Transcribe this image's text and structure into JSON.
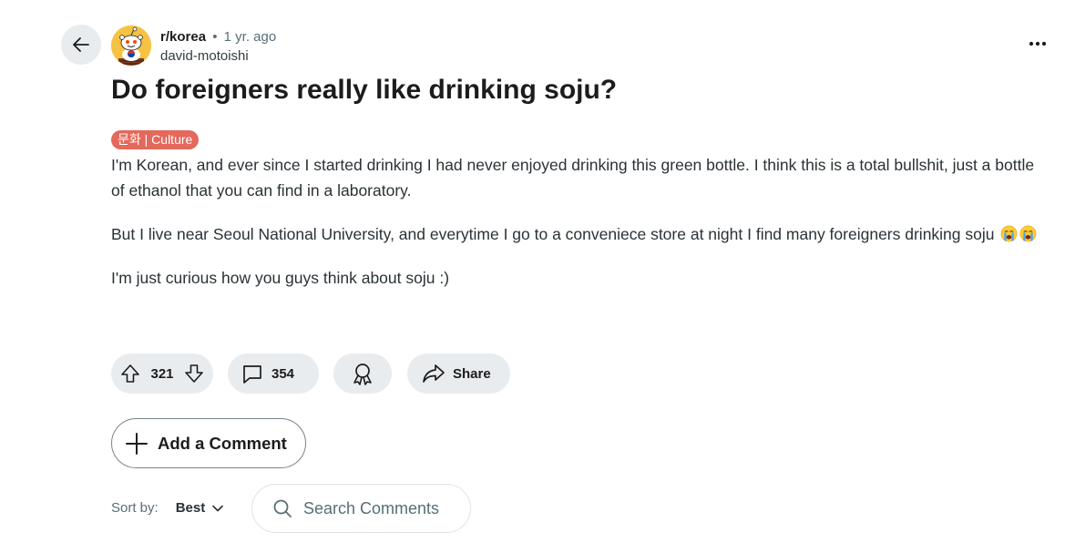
{
  "post": {
    "subreddit": "r/korea",
    "separator": "•",
    "time": "1 yr. ago",
    "author": "david-motoishi",
    "title": "Do foreigners really like drinking soju?",
    "flair": "문화 | Culture",
    "paragraphs": [
      "I'm Korean, and ever since I started drinking I had never enjoyed drinking this green bottle. I think this is a total bullshit, just a bottle of ethanol that you can find in a laboratory.",
      "But I live near Seoul National University, and everytime I go to a conveniece store at night I find many foreigners drinking soju",
      "I'm just curious how you guys think about soju :)"
    ]
  },
  "actions": {
    "votes": "321",
    "comments": "354",
    "share_label": "Share"
  },
  "comment_box": {
    "add_label": "Add a Comment",
    "sort_label": "Sort by:",
    "sort_value": "Best",
    "search_placeholder": "Search Comments"
  },
  "icons": {
    "back": "arrow-left-icon",
    "more": "ellipsis-icon",
    "upvote": "upvote-icon",
    "downvote": "downvote-icon",
    "comment": "comment-icon",
    "award": "award-icon",
    "share": "share-icon",
    "add": "plus-icon",
    "sort": "chevron-down-icon",
    "search": "search-icon",
    "emoji": "loudly-crying-face-icon"
  },
  "colors": {
    "flair_bg": "#e4685b",
    "pill_bg": "#e9ecef",
    "avatar_bg": "#f6c244"
  }
}
